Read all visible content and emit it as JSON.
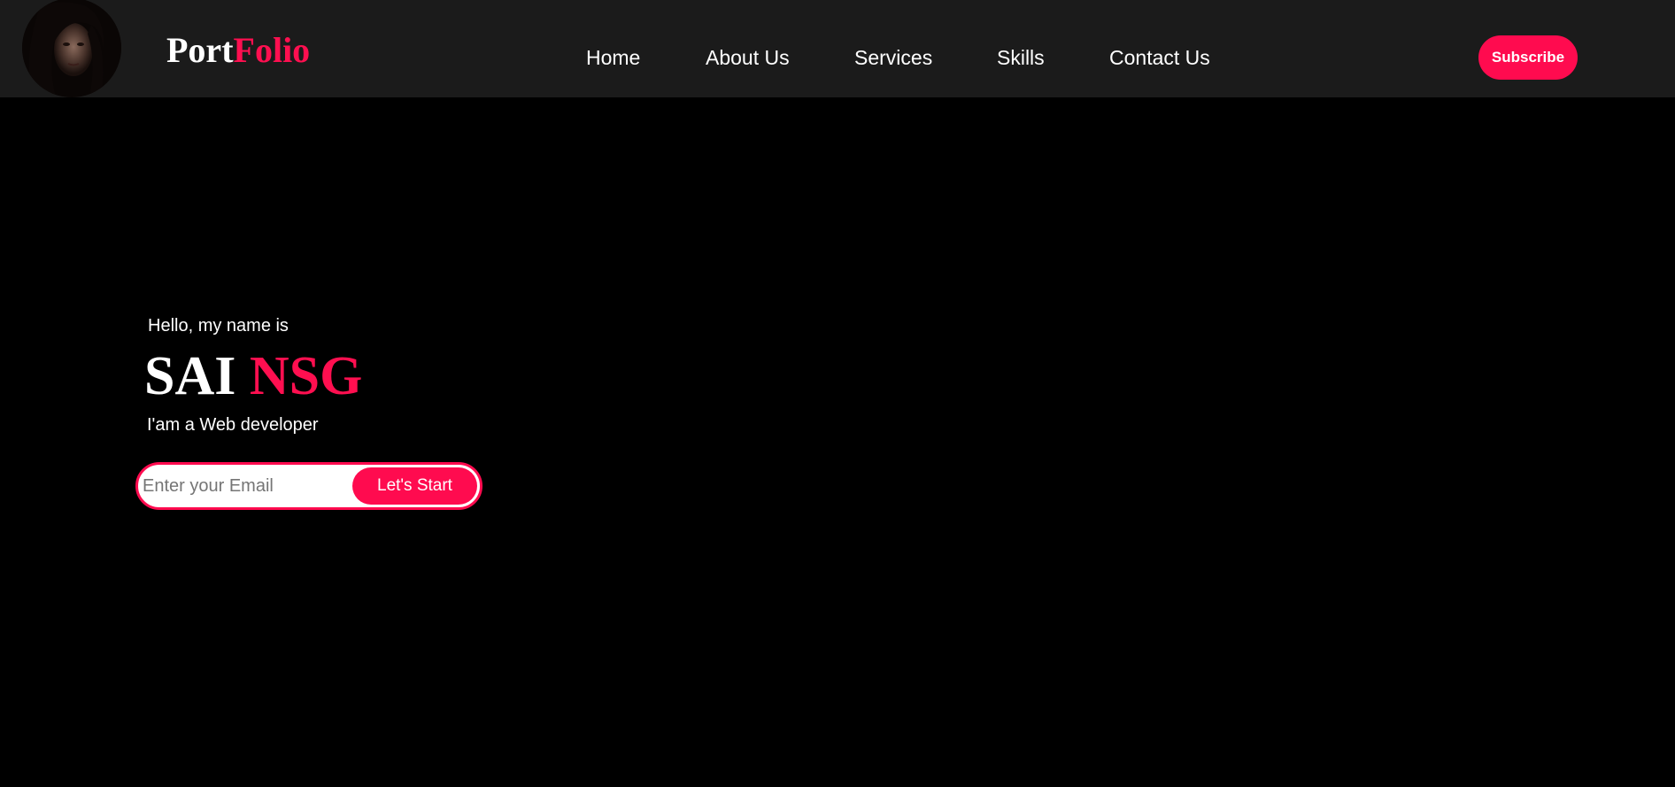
{
  "header": {
    "logo_part1": "Port",
    "logo_part2": "Folio",
    "nav": [
      {
        "label": "Home"
      },
      {
        "label": "About Us"
      },
      {
        "label": "Services"
      },
      {
        "label": "Skills"
      },
      {
        "label": "Contact Us"
      }
    ],
    "subscribe_label": "Subscribe"
  },
  "hero": {
    "greeting": "Hello, my name is",
    "first_name": "SAI",
    "last_name": "NSG",
    "role": "I'am a Web developer",
    "email_placeholder": "Enter your Email",
    "start_label": "Let's Start"
  },
  "colors": {
    "accent": "#ff0b4f",
    "navbar_bg": "#1b1b1b",
    "page_bg": "#000000",
    "text": "#ffffff"
  },
  "icons": {
    "avatar": "profile-photo"
  }
}
